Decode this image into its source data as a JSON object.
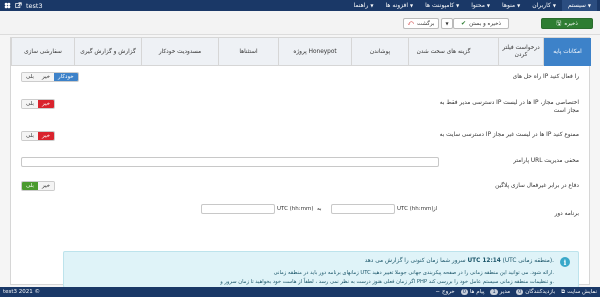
{
  "navbar": {
    "site_name": "test3",
    "menu": [
      {
        "label": "سیستم"
      },
      {
        "label": "کاربران"
      },
      {
        "label": "منوها"
      },
      {
        "label": "محتوا"
      },
      {
        "label": "کامپوننت ها"
      },
      {
        "label": "افزونه ها"
      },
      {
        "label": "راهنما"
      }
    ]
  },
  "toolbar": {
    "save_label": "ذخیره",
    "save_close_label": "ذخیره و بستن",
    "back_label": "برگشت"
  },
  "tabs": [
    {
      "label": "امکانات پایه"
    },
    {
      "label": "درخواست فیلتر کردن"
    },
    {
      "label": "گزینه های سخت شدن"
    },
    {
      "label": "پوشاندن"
    },
    {
      "label": "پروژه Honeypot"
    },
    {
      "label": "استثناها"
    },
    {
      "label": "مسدودیت خودکار"
    },
    {
      "label": "گزارش و گزارش گیری"
    },
    {
      "label": "سفارشی سازی"
    }
  ],
  "form": {
    "row1": {
      "label": "راه حل های IP را فعال کنید",
      "on": "خودکار",
      "mid": "خیر",
      "off": "بلی"
    },
    "row2": {
      "label": "دسترسی مدیر فقط به IP ها در لیست IP اختصاصی مجاز، مجاز است",
      "left": "بلی",
      "right": "خیر"
    },
    "row3": {
      "label": "دسترسی سایت به IP ها در لیست غیر مجاز IP ممنوع کنید",
      "left": "بلی",
      "right": "خیر"
    },
    "row4": {
      "label": "پارامتر URL مخفی مدیریت",
      "value": ""
    },
    "row5": {
      "label": "دفاع در برابر غیرفعال سازی پلاگین",
      "left": "بلی",
      "right": "خیر"
    },
    "row6": {
      "label": "برنامه دور",
      "from_label": "از",
      "tz_label_1": "UTC (hh:mm)",
      "to_label": "به",
      "tz_label_2": "UTC (hh:mm)"
    }
  },
  "info": {
    "line1_pre": "سرور شما زمان کنونی را گزارش می دهد",
    "line1_time": "UTC 12:14",
    "line1_post": "(UTC منطقه زمانی).",
    "line2": "زمانهای برنامه دور باید در منطقه زمانی UTC ارائه شود. می توانید این منطقه زمانی را در صفحه پیکربندی جهانی جوملا تغییر دهید.",
    "line3": "اگر زمان فعلی هنوز درست به نظر نمی رسد ، لطفاً از هاست خود بخواهید تا زمان سرور و PHP و تنظیمات منطقه زمانی سیستم عامل خود را بررسی کند."
  },
  "footer": {
    "copyright": "test3 2021 ©",
    "items": [
      {
        "label": "نمایش سایت"
      },
      {
        "label": "بازدیدکنندگان",
        "count": "0"
      },
      {
        "label": "مدیر",
        "count": "1"
      },
      {
        "label": "پیام ها",
        "count": "0"
      },
      {
        "label": "خروج"
      }
    ]
  }
}
